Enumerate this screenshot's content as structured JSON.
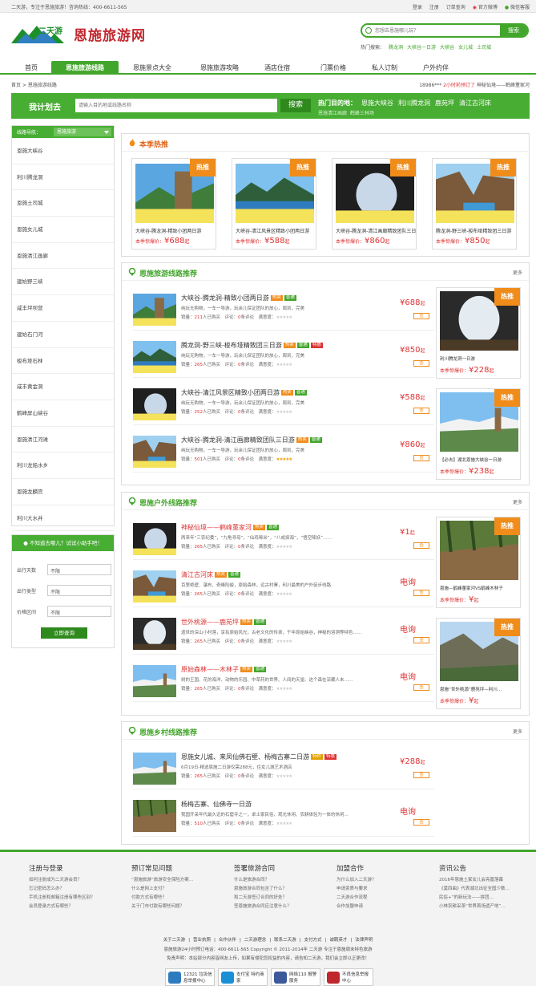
{
  "topbar": {
    "slogan": "二天游，专注于恩施旅游！咨询热线：400-6611-565",
    "links": [
      "登录",
      "注册",
      "订单查询",
      "官方微博",
      "微信客服"
    ]
  },
  "header": {
    "logo_text": "恩施旅游网",
    "logo_brand": "二天游",
    "search_placeholder": "您想去恩施哪儿玩？",
    "search_button": "搜索",
    "hot_label": "热门搜索：",
    "hot_terms": [
      "腾龙洞",
      "大峡谷一日游",
      "大峡谷",
      "女儿城",
      "土司城"
    ]
  },
  "nav": [
    "首页",
    "恩施旅游线路",
    "恩施景点大全",
    "恩施旅游攻略",
    "酒店住宿",
    "门票价格",
    "私人订制",
    "户外约伴"
  ],
  "breadcrumb": "首页 > 恩施旅游线路",
  "news": {
    "user": "18986***",
    "time": "2小时前预订了",
    "item": "神秘仙境——鹤峰董家河"
  },
  "plan": {
    "title": "我计划去",
    "placeholder": "请输入目的地或线路名称",
    "button": "搜索",
    "hot_label": "热门目的地：",
    "hot": [
      "恩施大峡谷",
      "利川腾龙洞",
      "鹿苑坪",
      "清江古河床"
    ],
    "hot2": [
      "恩施清江画廊",
      "鹤峰三林场"
    ]
  },
  "left": {
    "nav_label": "线路导航：",
    "nav_select": "恩施旅游",
    "items": [
      "恩施大峡谷",
      "利川腾龙洞",
      "恩施土司城",
      "恩施女儿城",
      "恩施清江画廊",
      "建始野三峡",
      "咸丰坪坝营",
      "建始石门河",
      "梭布垭石林",
      "咸丰黄金洞",
      "鹤峰屏山峡谷",
      "恩施清江河滩",
      "利川龙船水乡",
      "恩施龙麟宫",
      "利川大水井"
    ]
  },
  "ask": {
    "title": "不知道去哪儿？试试小助手吧！",
    "rows": [
      {
        "label": "出行天数",
        "value": "不限"
      },
      {
        "label": "出行类型",
        "value": "不限"
      },
      {
        "label": "价格区间",
        "value": "不限"
      }
    ],
    "button": "立即查询"
  },
  "hot_season": {
    "title": "本季热推",
    "badge": "热推",
    "cards": [
      {
        "title": "大峡谷-腾龙洞-精致小团两日游",
        "price_label": "本季惊爆价：",
        "price": "¥688",
        "unit": "起"
      },
      {
        "title": "大峡谷-清江风景区精致小团两日游",
        "price_label": "本季惊爆价：",
        "price": "¥588",
        "unit": "起"
      },
      {
        "title": "大峡谷-腾龙洞-清江画廊精致团队三日游",
        "price_label": "本季惊爆价：",
        "price": "¥860",
        "unit": "起"
      },
      {
        "title": "腾龙洞-野三峡-梭布垭精致团三日游",
        "price_label": "本季惊爆价：",
        "price": "¥850",
        "unit": "起"
      }
    ]
  },
  "routes": {
    "title": "恩施旅游线路推荐",
    "more": "更多",
    "items": [
      {
        "title": "大峡谷-腾龙洞-精致小团两日游",
        "tags": [
          "热卖",
          "普通"
        ],
        "desc": "纯玩无购物，一车一导游，玩余儿保证团队的放心，周到，完美",
        "sales": "211",
        "reviews": "0",
        "stars": 0,
        "price": "¥688",
        "go": "查"
      },
      {
        "title": "腾龙洞-野三峡-梭布垭精致团三日游",
        "tags": [
          "热卖",
          "普通",
          "特惠"
        ],
        "desc": "纯玩无购物，一车一导游，玩余儿保证团队的放心，周到，完美",
        "sales": "265",
        "reviews": "0",
        "stars": 0,
        "price": "¥850",
        "go": "查"
      },
      {
        "title": "大峡谷-清江风景区精致小团两日游",
        "tags": [
          "热卖",
          "普通"
        ],
        "desc": "纯玩无购物，一车一导游，玩余儿保证团队的放心，周到，完美",
        "sales": "252",
        "reviews": "0",
        "stars": 0,
        "price": "¥588",
        "go": "查"
      },
      {
        "title": "大峡谷-腾龙洞-清江画廊精致团队三日游",
        "tags": [
          "热卖",
          "普通"
        ],
        "desc": "纯玩无购物，一车一导游，玩余儿保证团队的放心，周到，完美",
        "sales": "501",
        "reviews": "0",
        "stars": 5,
        "price": "¥860",
        "go": "查"
      }
    ],
    "side": [
      {
        "title": "利川腾龙洞一日游",
        "price_label": "本季惊爆价：",
        "price": "¥228",
        "unit": "起"
      },
      {
        "title": "【必去】湖北恩施大峡谷一日游",
        "price_label": "本季惊爆价：",
        "price": "¥238",
        "unit": "起"
      }
    ]
  },
  "outdoor": {
    "title": "恩施户外线路推荐",
    "more": "更多",
    "items": [
      {
        "title": "神秘仙境——鹤峰董家河",
        "tags": [
          "热卖",
          "普通"
        ],
        "desc": "两来年“三农纪委”，“九龟寻母”，“仙鸡啄米”，“八戒探海”，“悟空降妖”……",
        "sales": "265",
        "reviews": "0",
        "stars": 0,
        "price": "¥1",
        "go": "查"
      },
      {
        "title": "清江古河床",
        "tags": [
          "热卖",
          "普通"
        ],
        "desc": "百里绝壁、瀑布、奇峰险峻，原始森林，远古村寨，利川最美的户外徒步线路",
        "sales": "265",
        "reviews": "0",
        "stars": 0,
        "price": "电询",
        "go": "查"
      },
      {
        "title": "世外桃源——鹿苑坪",
        "tags": [
          "热卖",
          "普通"
        ],
        "desc": "遗世的深山小村落，享有原始风光，古老文化的传承，千年原始峡谷，神秘的溶洞等特色……",
        "sales": "265",
        "reviews": "0",
        "stars": 0,
        "price": "电询",
        "go": "查"
      },
      {
        "title": "原始森林——木林子",
        "tags": [
          "热卖",
          "普通"
        ],
        "desc": "树的王国、花的海洋、动物的乐园、中草药的世界、人间的天堂。这个森在深藏人未……",
        "sales": "265",
        "reviews": "0",
        "stars": 0,
        "price": "电询",
        "go": "查"
      }
    ],
    "side": [
      {
        "title": "恩施—鹤峰董家河VS鹤峰木林子",
        "price_label": "本季惊爆价：",
        "price": "¥",
        "unit": "起"
      },
      {
        "title": "恩施“世外桃源”鹿苑坪—利川…",
        "price_label": "本季惊爆价：",
        "price": "¥",
        "unit": "起"
      }
    ]
  },
  "village": {
    "title": "恩施乡村线路推荐",
    "more": "更多",
    "items": [
      {
        "title": "恩施女儿城、来凤仙佛石壁、杨梅古寨二日游",
        "tags": [
          "特价",
          "特惠"
        ],
        "desc": "6月19日-精选恩施二日游仅需288元，住女儿城艺术酒店",
        "sales": "265",
        "reviews": "0",
        "stars": 0,
        "price": "¥288",
        "go": "查"
      },
      {
        "title": "杨梅古寨、仙佛寺一日游",
        "tags": [],
        "desc": "我国开采年代最久远的石窟寺之一，卓士家民俗、观光休闲、农耕体验为一体的休闲…",
        "sales": "510",
        "reviews": "0",
        "stars": 0,
        "price": "电询",
        "go": "查"
      }
    ]
  },
  "footer": {
    "cols": [
      {
        "h": "注册与登录",
        "l": [
          "如何注册成为二天游会员？",
          "忘记密码怎么办？",
          "手机注册和邮箱注册有哪些区别？",
          "会员登录方式有哪些？"
        ]
      },
      {
        "h": "预订常见问题",
        "l": [
          "“恩施旅游”旅游安全保险方案…",
          "什么是网上支付？",
          "付款方式有哪些？",
          "关于门市付款有哪些问题？"
        ]
      },
      {
        "h": "签署旅游合同",
        "l": [
          "什么是旅游合同？",
          "恩施旅游合同包含了什么？",
          "和二天游签订合同的好处？",
          "签恩施旅游合同应注意什么？"
        ]
      },
      {
        "h": "加盟合作",
        "l": [
          "为什么加入二天游？",
          "申请资质与要求",
          "二天游合作流程",
          "合作加盟申请"
        ]
      },
      {
        "h": "资讯公告",
        "l": [
          "2016年恩施土家女儿会亮嘉落幕",
          "《莫四曲》代表湖北出征全国少数…",
          "民俗+”的新玩法——拼团…",
          "小林农耕采茶“世界首场遗产地”…"
        ]
      }
    ],
    "links": [
      "关于二天游",
      "营业执照",
      "合作伙伴",
      "二天游理念",
      "联系二天游",
      "支付方式",
      "诚聘英才",
      "法律声明"
    ],
    "copy1": "恩施旅游24小时预订电话：400-6611-565 Copyright © 2011-2014年 二天游 专注于恩施周末特色旅游",
    "copy2": "免责声明：本站部分内容皆网友上传，如果有侵犯您权益的内容，请告知二天游，我们会立即以正更改！",
    "certs": [
      "12321 垃圾信息举报中心",
      "支付宝 特约商家",
      "网络110 报警服务",
      "不良信息举报中心"
    ]
  },
  "colors": {
    "green": "#43a62c",
    "red": "#d33333",
    "orange": "#f08c1a"
  }
}
